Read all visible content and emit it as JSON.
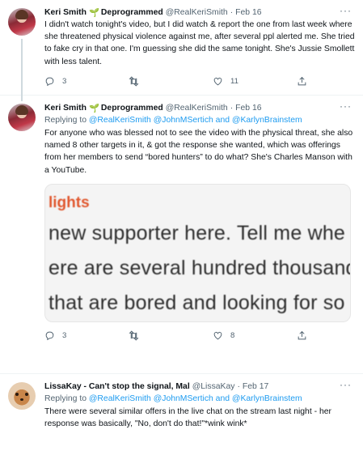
{
  "tweets": [
    {
      "name": "Keri Smith",
      "badge": "Deprogrammed",
      "handle": "@RealKeriSmith",
      "time": "Feb 16",
      "replying_prefix": "",
      "replying_mentions": "",
      "text": "I didn't watch tonight's video, but I did watch & report the one from last week where she threatened physical violence against me, after several ppl alerted me. She tried to fake cry in that one. I'm guessing she did the same tonight. She's Jussie Smollett with less talent.",
      "replies": "3",
      "retweets": "",
      "likes": "11"
    },
    {
      "name": "Keri Smith",
      "badge": "Deprogrammed",
      "handle": "@RealKeriSmith",
      "time": "Feb 16",
      "replying_prefix": "Replying to",
      "replying_mentions": "@RealKeriSmith @JohnMSertich and @KarlynBrainstem",
      "text": "For anyone who was blessed not to see the video with the physical threat, she also named 8 other targets in it, & got the response she wanted, which was offerings from her members to send “bored hunters” to do what? She's Charles Manson with a YouTube.",
      "media": {
        "heading": "lights",
        "line1": "new supporter here. Tell me whe",
        "line2": "ere are several hundred thousand",
        "line3": "that are bored and looking for so"
      },
      "replies": "3",
      "retweets": "",
      "likes": "8"
    },
    {
      "name": "LissaKay - Can't stop the signal, Mal",
      "handle": "@LissaKay",
      "time": "Feb 17",
      "replying_prefix": "Replying to",
      "replying_mentions": "@RealKeriSmith @JohnMSertich and @KarlynBrainstem",
      "text": "There were several similar offers in the live chat on the stream last night - her response was basically, \"No, don't do that!\"*wink wink*",
      "replies": "",
      "retweets": "",
      "likes": ""
    }
  ],
  "ui": {
    "dot": "·",
    "more": "···",
    "sprout": "🌱"
  },
  "icons": [
    "reply-icon",
    "retweet-icon",
    "like-icon",
    "share-icon",
    "more-icon",
    "sprout-icon"
  ],
  "colors": {
    "link": "#1d9bf0",
    "secondary_text": "#536471",
    "primary_text": "#0f1419"
  }
}
